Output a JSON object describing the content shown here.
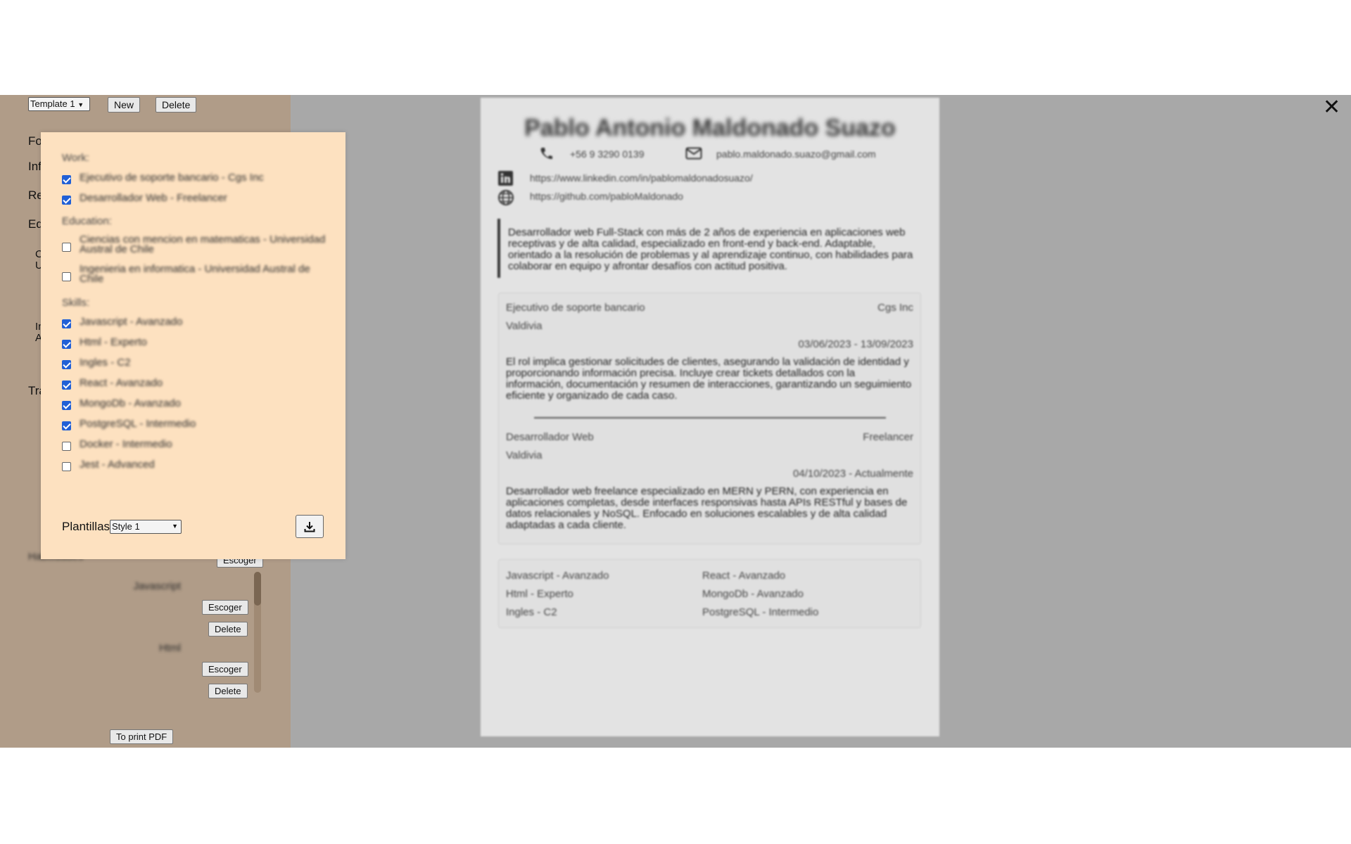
{
  "toolbar": {
    "template_select": "Template 1",
    "new_label": "New",
    "delete_label": "Delete"
  },
  "sidebar": {
    "fragments": [
      "Fo",
      "Inf",
      "Re",
      "Ed",
      "C",
      "U",
      "In",
      "A",
      "Tra"
    ],
    "skills_label": "Habilidades",
    "escoger_label": "Escoger",
    "skills": [
      {
        "name": "Javascript",
        "escoger": "Escoger",
        "delete": "Delete"
      },
      {
        "name": "Html",
        "escoger": "Escoger",
        "delete": "Delete"
      }
    ],
    "print_label": "To print PDF"
  },
  "popup": {
    "work_heading": "Work:",
    "work": [
      {
        "text": "Ejecutivo de soporte bancario - Cgs Inc",
        "checked": true
      },
      {
        "text": "Desarrollador Web - Freelancer",
        "checked": true
      }
    ],
    "education_heading": "Education:",
    "education": [
      {
        "text": "Ciencias con mencion en matematicas - Universidad Austral de Chile",
        "checked": false
      },
      {
        "text": "Ingenieria en informatica - Universidad Austral de Chile",
        "checked": false
      }
    ],
    "skills_heading": "Skills:",
    "skills": [
      {
        "text": "Javascript - Avanzado",
        "checked": true
      },
      {
        "text": "Html - Experto",
        "checked": true
      },
      {
        "text": "Ingles - C2",
        "checked": true
      },
      {
        "text": "React - Avanzado",
        "checked": true
      },
      {
        "text": "MongoDb - Avanzado",
        "checked": true
      },
      {
        "text": "PostgreSQL - Intermedio",
        "checked": true
      },
      {
        "text": "Docker - Intermedio",
        "checked": false
      },
      {
        "text": "Jest - Advanced",
        "checked": false
      }
    ],
    "plantillas_label": "Plantillas:",
    "style_select": "Style 1",
    "download_icon": "download-icon"
  },
  "close_icon": "close-icon",
  "resume": {
    "name": "Pablo Antonio Maldonado Suazo",
    "phone": "+56 9 3290 0139",
    "email": "pablo.maldonado.suazo@gmail.com",
    "linkedin": "https://www.linkedin.com/in/pablomaldonadosuazo/",
    "github": "https://github.com/pabloMaldonado",
    "summary": "Desarrollador web Full-Stack con más de 2 años de experiencia en aplicaciones web receptivas y de alta calidad, especializado en front-end y back-end. Adaptable, orientado a la resolución de problemas y al aprendizaje continuo, con habilidades para colaborar en equipo y afrontar desafíos con actitud positiva.",
    "jobs": [
      {
        "title": "Ejecutivo de soporte bancario",
        "company": "Cgs Inc",
        "location": "Valdivia",
        "dates": "03/06/2023 - 13/09/2023",
        "description": "El rol implica gestionar solicitudes de clientes, asegurando la validación de identidad y proporcionando información precisa. Incluye crear tickets detallados con la información, documentación y resumen de interacciones, garantizando un seguimiento eficiente y organizado de cada caso."
      },
      {
        "title": "Desarrollador Web",
        "company": "Freelancer",
        "location": "Valdivia",
        "dates": "04/10/2023 - Actualmente",
        "description": "Desarrollador web freelance especializado en MERN y PERN, con experiencia en aplicaciones completas, desde interfaces responsivas hasta APIs RESTful y bases de datos relacionales y NoSQL. Enfocado en soluciones escalables y de alta calidad adaptadas a cada cliente."
      }
    ],
    "skills": [
      "Javascript - Avanzado",
      "React - Avanzado",
      "Html - Experto",
      "MongoDb - Avanzado",
      "Ingles - C2",
      "PostgreSQL - Intermedio"
    ]
  }
}
